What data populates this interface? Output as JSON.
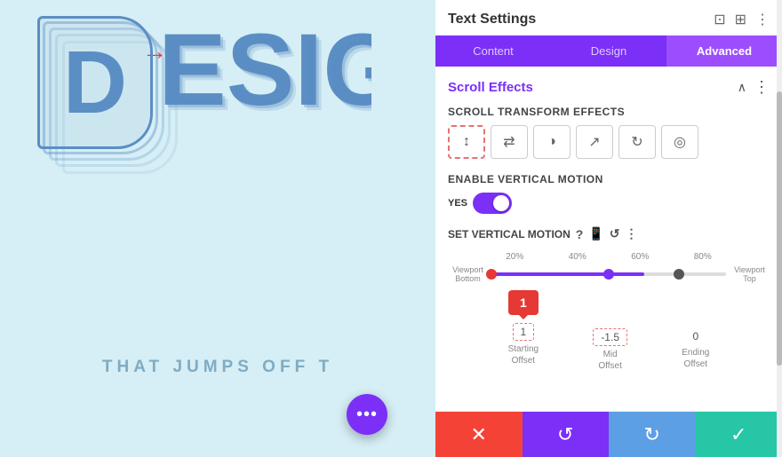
{
  "left": {
    "subtitle": "THAT JUMPS OFF T",
    "arrow_label": "arrow",
    "float_btn_label": "•••"
  },
  "right": {
    "header": {
      "title": "Text Settings",
      "icons": [
        "screen-icon",
        "layout-icon",
        "more-icon"
      ]
    },
    "tabs": [
      {
        "label": "Content",
        "active": false
      },
      {
        "label": "Design",
        "active": false
      },
      {
        "label": "Advanced",
        "active": true
      }
    ],
    "section": {
      "title": "Scroll Effects"
    },
    "scroll_transform": {
      "label": "Scroll Transform Effects",
      "icons": [
        {
          "name": "vertical-motion",
          "symbol": "↕",
          "active": true
        },
        {
          "name": "horizontal-motion",
          "symbol": "⇄",
          "active": false
        },
        {
          "name": "fade",
          "symbol": "◑",
          "active": false
        },
        {
          "name": "blur",
          "symbol": "↗",
          "active": false
        },
        {
          "name": "rotate",
          "symbol": "↻",
          "active": false
        },
        {
          "name": "scale",
          "symbol": "◎",
          "active": false
        }
      ]
    },
    "vertical_motion": {
      "label": "Enable Vertical Motion",
      "toggle_yes": "YES",
      "enabled": true
    },
    "set_vertical": {
      "label": "Set Vertical Motion",
      "icons": [
        "help",
        "mobile",
        "reset",
        "more"
      ]
    },
    "percent_labels": [
      "20%",
      "40%",
      "60%",
      "80%"
    ],
    "viewport_bottom": "Viewport\nBottom",
    "viewport_top": "Viewport\nTop",
    "offsets": [
      {
        "label": "Starting\nOffset",
        "value": "1",
        "badge": true,
        "dashed": true
      },
      {
        "label": "Mid\nOffset",
        "value": "-1.5",
        "badge": false,
        "dashed": true
      },
      {
        "label": "Ending\nOffset",
        "value": "0",
        "badge": false,
        "dashed": false
      }
    ]
  },
  "action_bar": {
    "cancel_icon": "✕",
    "undo_icon": "↺",
    "redo_icon": "↻",
    "confirm_icon": "✓"
  }
}
